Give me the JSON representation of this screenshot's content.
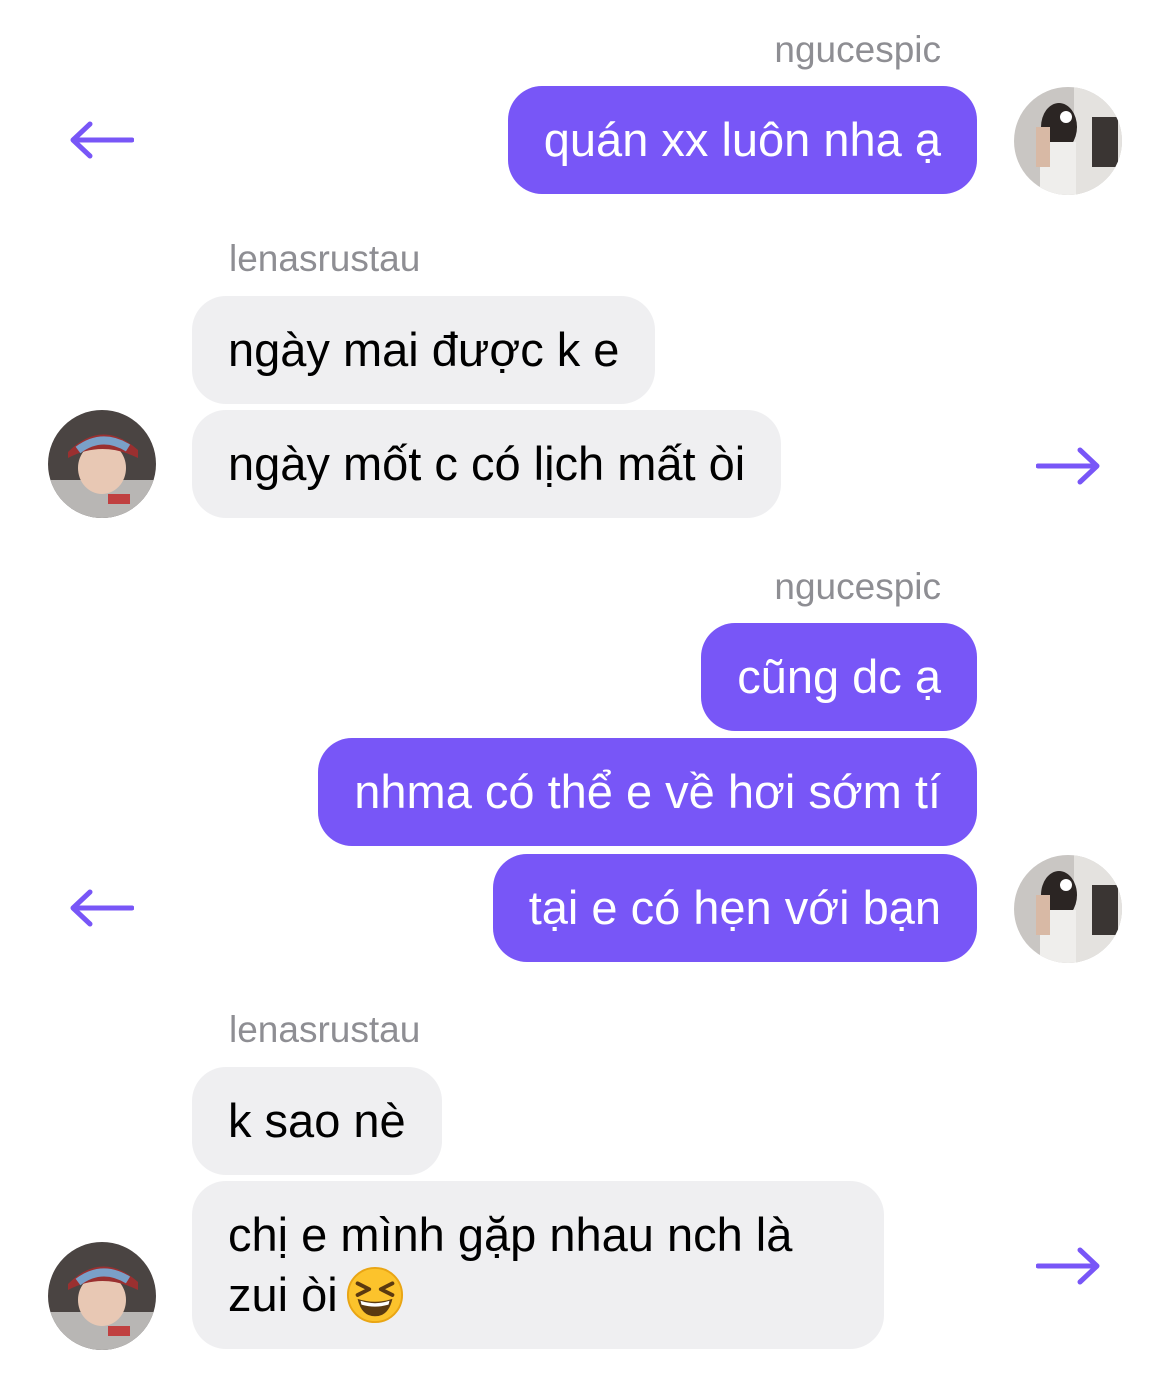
{
  "messages": [
    {
      "sender": "ngucespic",
      "side": "right",
      "bubbles": [
        "quán xx luôn nha ạ"
      ]
    },
    {
      "sender": "lenasrustau",
      "side": "left",
      "bubbles": [
        "ngày mai được k e",
        "ngày mốt c có lịch mất òi"
      ]
    },
    {
      "sender": "ngucespic",
      "side": "right",
      "bubbles": [
        "cũng dc ạ",
        "nhma có thể e về hơi sớm tí",
        "tại e có hẹn với bạn"
      ]
    },
    {
      "sender": "lenasrustau",
      "side": "left",
      "bubbles": [
        "k sao nè",
        "chị e mình gặp nhau nch là",
        "zui òi"
      ]
    }
  ],
  "icons": {
    "reply_arrow_left": "arrow-left-icon",
    "reply_arrow_right": "arrow-right-icon",
    "emoji": "grinning-squinting-face-emoji"
  },
  "colors": {
    "outgoing_bubble": "#7856f7",
    "incoming_bubble": "#efeff1",
    "username_text": "#8e8e93",
    "arrow": "#7856f7"
  }
}
